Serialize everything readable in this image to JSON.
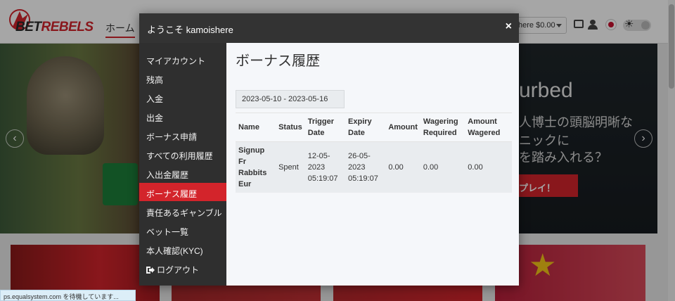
{
  "site": {
    "logo_bet": "BET",
    "logo_rebels": "REBELS",
    "nav_home": "ホーム",
    "balance": "here $0.00",
    "hero_title": "urbed",
    "hero_line1": "人博士の頭脳明晰な",
    "hero_line2": "ニックに",
    "hero_line3": "を踏み入れる？",
    "hero_play": "プレイ！",
    "status_text": "ps.equalsystem.com を待機しています..."
  },
  "modal": {
    "title": "ようこそ kamoishere",
    "close_glyph": "×",
    "sidebar": {
      "items": [
        {
          "label": "マイアカウント"
        },
        {
          "label": "残高"
        },
        {
          "label": "入金"
        },
        {
          "label": "出金"
        },
        {
          "label": "ボーナス申請"
        },
        {
          "label": "すべての利用履歴"
        },
        {
          "label": "入出金履歴"
        },
        {
          "label": "ボーナス履歴",
          "active": true
        },
        {
          "label": "責任あるギャンブル"
        },
        {
          "label": "ベット一覧"
        },
        {
          "label": "本人確認(KYC)"
        },
        {
          "label": "ログアウト"
        }
      ]
    },
    "content": {
      "heading": "ボーナス履歴",
      "date_range": "2023-05-10 - 2023-05-16",
      "table": {
        "headers": [
          "Name",
          "Status",
          "Trigger Date",
          "Expiry Date",
          "Amount",
          "Wagering Required",
          "Amount Wagered"
        ],
        "rows": [
          {
            "name": "Signup Fr Rabbits Eur",
            "status": "Spent",
            "trigger_date": "12-05-2023 05:19:07",
            "expiry_date": "26-05-2023 05:19:07",
            "amount": "0.00",
            "wagering_required": "0.00",
            "amount_wagered": "0.00"
          }
        ]
      }
    }
  },
  "colors": {
    "accent_red": "#d3242b",
    "modal_header": "#333333",
    "sidebar_bg": "#2f2f2f"
  }
}
